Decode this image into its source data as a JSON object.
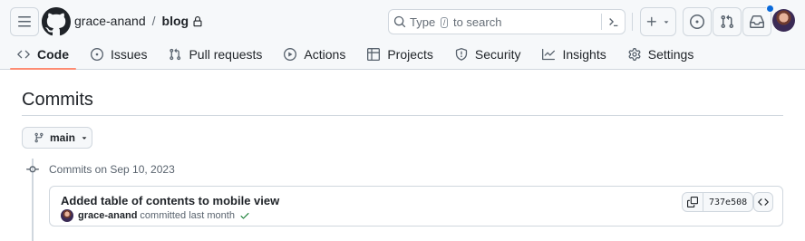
{
  "header": {
    "owner": "grace-anand",
    "separator": "/",
    "repo": "blog",
    "search": {
      "prefix": "Type",
      "key": "/",
      "suffix": "to search"
    },
    "notification_dot_color": "#0969da"
  },
  "tabs": [
    {
      "label": "Code",
      "icon": "code-icon",
      "active": true
    },
    {
      "label": "Issues",
      "icon": "issue-opened-icon"
    },
    {
      "label": "Pull requests",
      "icon": "git-pull-request-icon"
    },
    {
      "label": "Actions",
      "icon": "play-icon"
    },
    {
      "label": "Projects",
      "icon": "table-icon"
    },
    {
      "label": "Security",
      "icon": "shield-icon"
    },
    {
      "label": "Insights",
      "icon": "graph-icon"
    },
    {
      "label": "Settings",
      "icon": "gear-icon"
    }
  ],
  "page": {
    "title": "Commits",
    "branch": "main"
  },
  "commit_groups": [
    {
      "date_label": "Commits on Sep 10, 2023",
      "commits": [
        {
          "message": "Added table of contents to mobile view",
          "author": "grace-anand",
          "action": "committed last month",
          "sha": "737e508",
          "status": "success"
        }
      ]
    }
  ],
  "colors": {
    "active_tab_underline": "#fd8c73",
    "success_check": "#1a7f37",
    "border": "#d0d7de"
  }
}
